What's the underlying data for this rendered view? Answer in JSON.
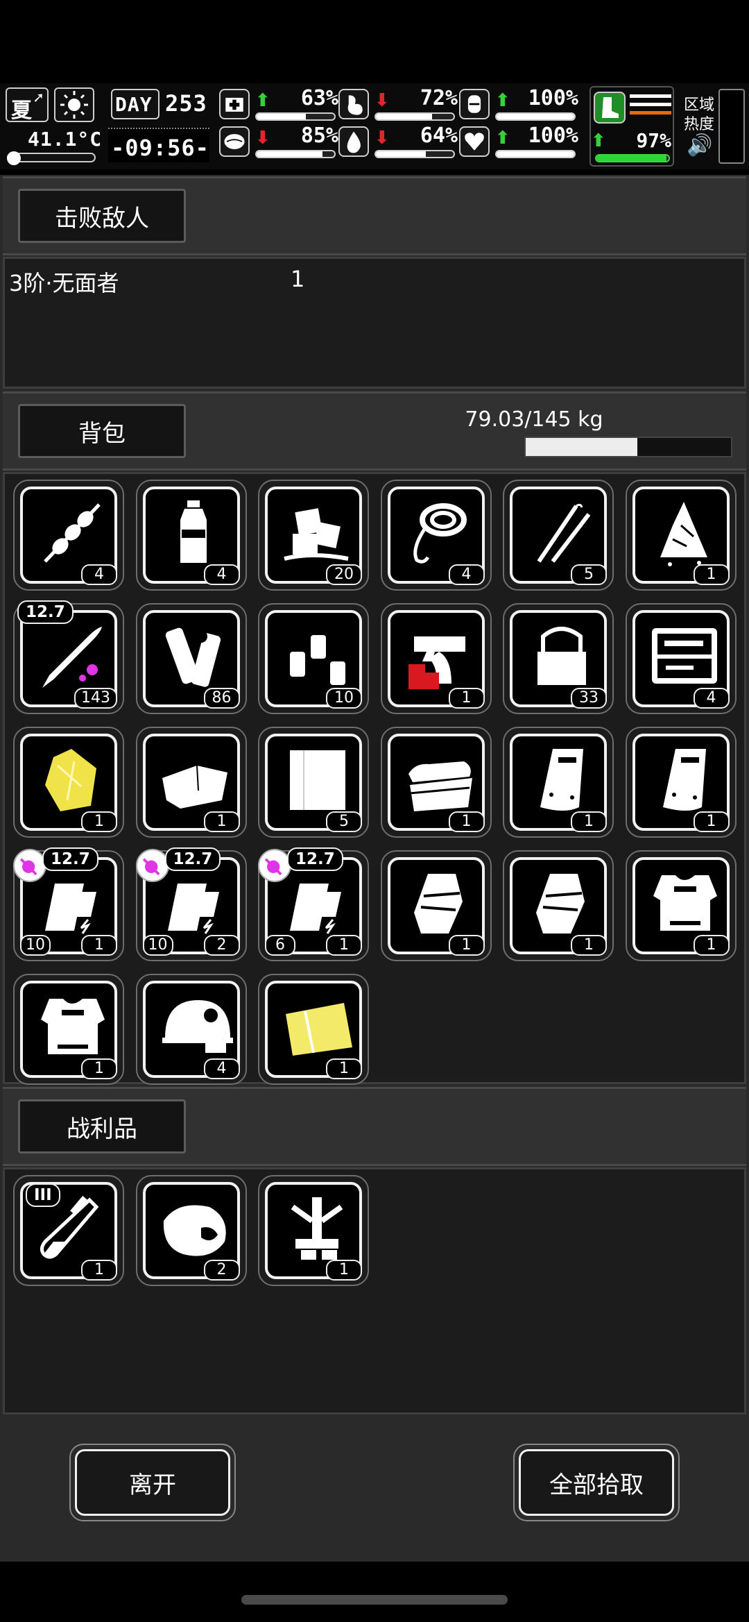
{
  "status": {
    "season": "夏",
    "temperature": "41.1°C",
    "day_label": "DAY",
    "day_number": "253",
    "clock": "-09:56-",
    "stats": [
      {
        "name": "health",
        "icon": "medkit-icon",
        "trend": "up",
        "value": "63%",
        "level": 0.63
      },
      {
        "name": "hunger",
        "icon": "stomach-icon",
        "trend": "down",
        "value": "72%",
        "level": 0.72
      },
      {
        "name": "mood",
        "icon": "face-icon",
        "trend": "up",
        "value": "100%",
        "level": 1.0
      },
      {
        "name": "mind",
        "icon": "brain-icon",
        "trend": "down",
        "value": "85%",
        "level": 0.85
      },
      {
        "name": "thirst",
        "icon": "water-drop-icon",
        "trend": "down",
        "value": "64%",
        "level": 0.64
      },
      {
        "name": "heart",
        "icon": "heart-icon",
        "trend": "up",
        "value": "100%",
        "level": 1.0
      }
    ],
    "stamina": {
      "icon": "boot-icon",
      "trend": "up",
      "value": "97%",
      "level": 0.97
    },
    "zone_heat_label": "区域\n热度"
  },
  "defeated": {
    "title": "击败敌人",
    "enemies": [
      {
        "name": "3阶·无面者",
        "count": "1"
      }
    ]
  },
  "backpack": {
    "title": "背包",
    "weight": "79.03/145 kg",
    "weight_fraction": 0.545,
    "items": [
      {
        "icon": "meat-skewer-icon",
        "count": "4"
      },
      {
        "icon": "water-bottle-icon",
        "count": "4"
      },
      {
        "icon": "ice-cubes-icon",
        "count": "20"
      },
      {
        "icon": "rope-icon",
        "count": "4"
      },
      {
        "icon": "lockpick-icon",
        "count": "5"
      },
      {
        "icon": "torn-cloth-icon",
        "count": "1"
      },
      {
        "icon": "bullet-icon",
        "caliber": "12.7",
        "count": "143"
      },
      {
        "icon": "pipes-icon",
        "count": "86"
      },
      {
        "icon": "spray-cans-icon",
        "count": "10"
      },
      {
        "icon": "flare-gun-icon",
        "count": "1"
      },
      {
        "icon": "tool-bag-icon",
        "count": "33"
      },
      {
        "icon": "toolbox-icon",
        "count": "4"
      },
      {
        "icon": "gold-ore-icon",
        "count": "1"
      },
      {
        "icon": "folded-cloth-icon",
        "count": "1"
      },
      {
        "icon": "fabric-sheet-icon",
        "count": "5"
      },
      {
        "icon": "towels-icon",
        "count": "1"
      },
      {
        "icon": "riot-shield-icon",
        "count": "1"
      },
      {
        "icon": "riot-shield-icon",
        "count": "1"
      },
      {
        "icon": "gun-magazine-icon",
        "caliber": "12.7",
        "marked": true,
        "ammo": "10",
        "count": "1"
      },
      {
        "icon": "gun-magazine-icon",
        "caliber": "12.7",
        "marked": true,
        "ammo": "10",
        "count": "2"
      },
      {
        "icon": "gun-magazine-icon",
        "caliber": "12.7",
        "marked": true,
        "ammo": "6",
        "count": "1"
      },
      {
        "icon": "armored-gauntlet-icon",
        "count": "1"
      },
      {
        "icon": "armored-gauntlet-icon",
        "count": "1"
      },
      {
        "icon": "body-armor-icon",
        "count": "1"
      },
      {
        "icon": "body-armor-icon",
        "count": "1"
      },
      {
        "icon": "military-helmet-icon",
        "count": "4"
      },
      {
        "icon": "yellow-cloth-icon",
        "count": "1"
      }
    ]
  },
  "loot": {
    "title": "战利品",
    "items": [
      {
        "icon": "test-tube-icon",
        "tier": "III",
        "count": "1"
      },
      {
        "icon": "raw-meat-icon",
        "count": "2"
      },
      {
        "icon": "mechanical-parts-icon",
        "count": "1"
      }
    ]
  },
  "actions": {
    "leave": "离开",
    "take_all": "全部拾取"
  }
}
